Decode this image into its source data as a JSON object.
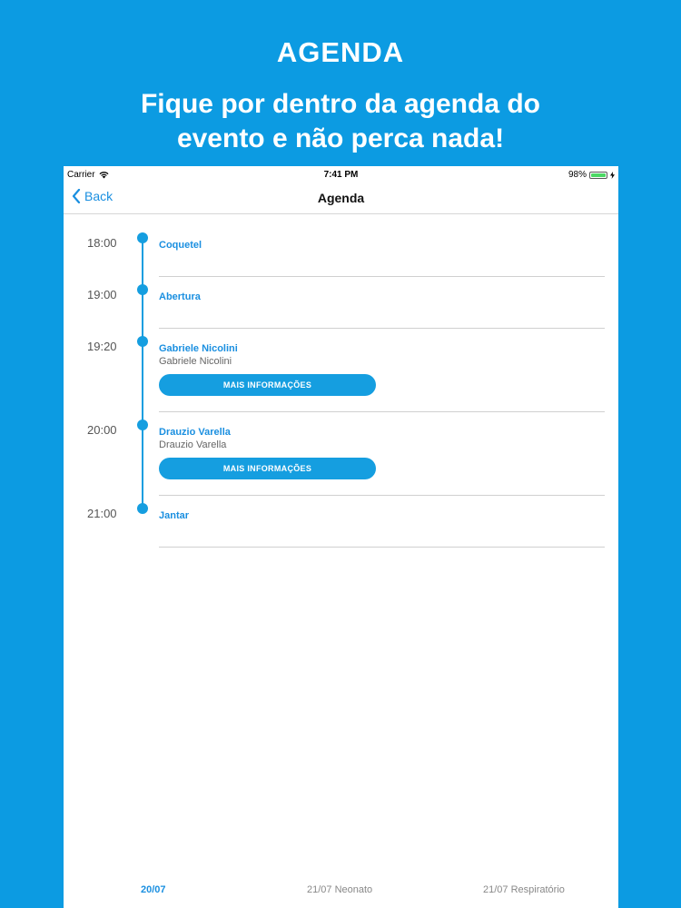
{
  "promo": {
    "title": "AGENDA",
    "subtitle_line1": "Fique por dentro da agenda do",
    "subtitle_line2": "evento e não perca nada!"
  },
  "status_bar": {
    "carrier": "Carrier",
    "time": "7:41 PM",
    "battery": "98%",
    "battery_level": 0.98
  },
  "nav": {
    "back_label": "Back",
    "title": "Agenda"
  },
  "events": [
    {
      "time": "18:00",
      "title": "Coquetel"
    },
    {
      "time": "19:00",
      "title": "Abertura"
    },
    {
      "time": "19:20",
      "title": "Gabriele Nicolini",
      "subtitle": "Gabriele Nicolini",
      "button": "MAIS INFORMAÇÕES"
    },
    {
      "time": "20:00",
      "title": "Drauzio Varella",
      "subtitle": "Drauzio Varella",
      "button": "MAIS INFORMAÇÕES"
    },
    {
      "time": "21:00",
      "title": "Jantar"
    }
  ],
  "tabs": [
    {
      "label": "20/07",
      "active": true
    },
    {
      "label": "21/07 Neonato",
      "active": false
    },
    {
      "label": "21/07 Respiratório",
      "active": false
    }
  ],
  "colors": {
    "background": "#0c9be2",
    "accent": "#1a8fe0",
    "battery": "#4cd964"
  }
}
